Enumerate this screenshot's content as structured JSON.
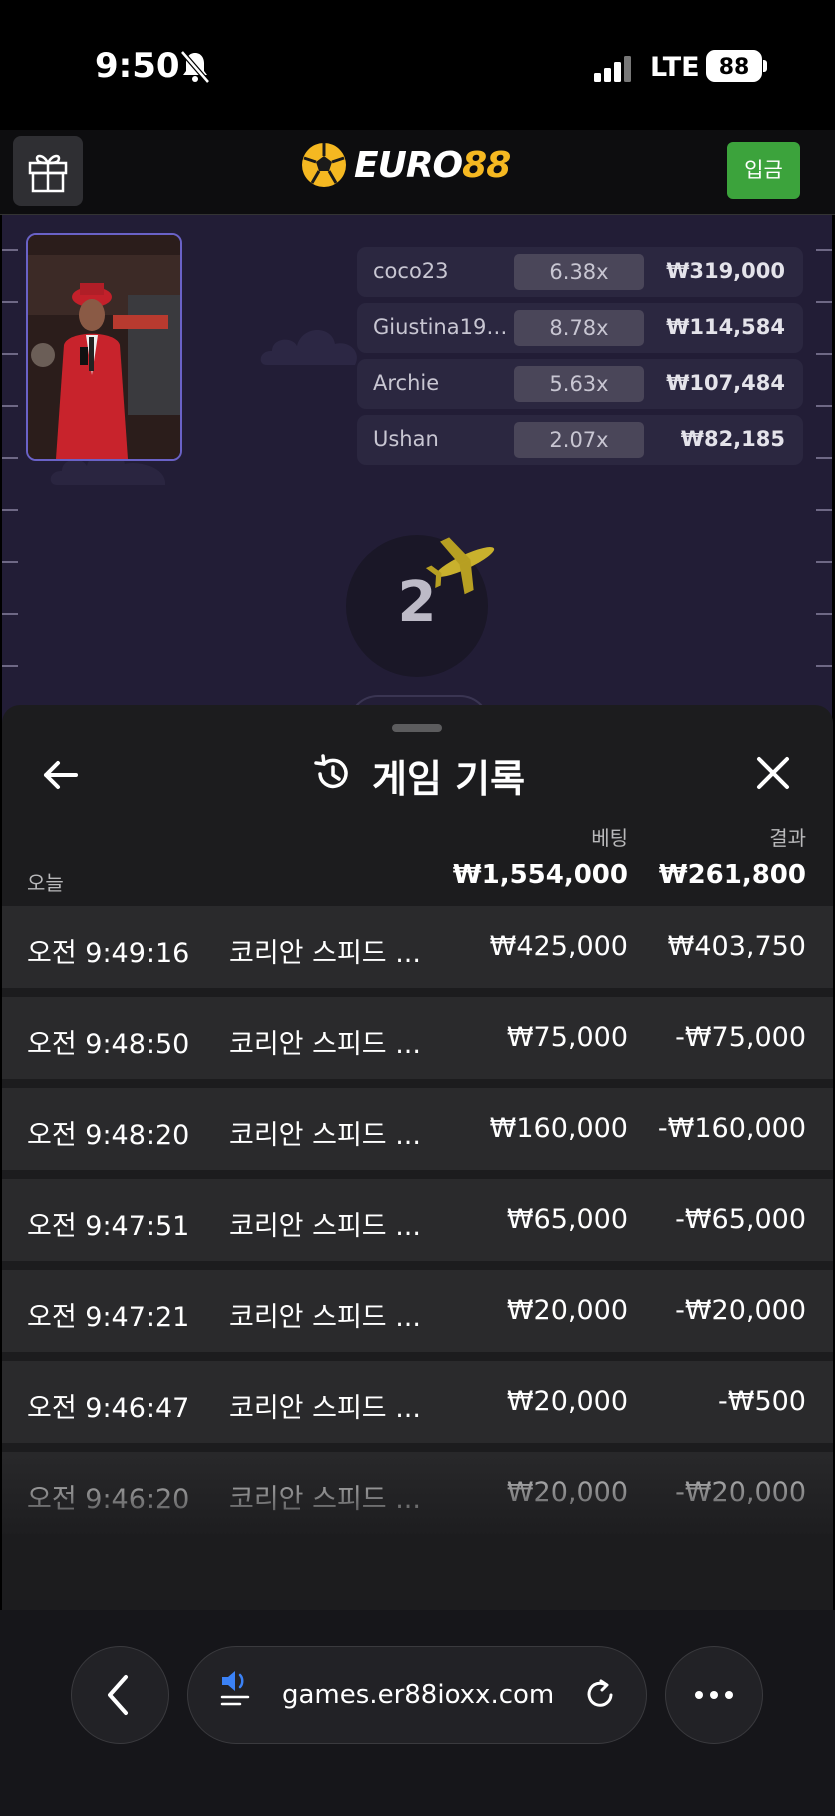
{
  "status_bar": {
    "time": "9:50",
    "network": "LTE",
    "battery": "88"
  },
  "header": {
    "logo": "EURO88",
    "logo_word": "EURO",
    "logo_number": "88",
    "deposit_label": "입금"
  },
  "live_bets": [
    {
      "name": "coco23",
      "multiplier": "6.38x",
      "amount": "₩319,000"
    },
    {
      "name": "Giustina19…",
      "multiplier": "8.78x",
      "amount": "₩114,584"
    },
    {
      "name": "Archie",
      "multiplier": "5.63x",
      "amount": "₩107,484"
    },
    {
      "name": "Ushan",
      "multiplier": "2.07x",
      "amount": "₩82,185"
    }
  ],
  "countdown": "2",
  "history": {
    "title": "게임 기록",
    "bet_header": "베팅",
    "result_header": "결과",
    "today_label": "오늘",
    "total_bet": "₩1,554,000",
    "total_result": "₩261,800",
    "rows": [
      {
        "time": "오전 9:49:16",
        "game": "코리안 스피드 ...",
        "bet": "₩425,000",
        "result": "₩403,750"
      },
      {
        "time": "오전 9:48:50",
        "game": "코리안 스피드 ...",
        "bet": "₩75,000",
        "result": "-₩75,000"
      },
      {
        "time": "오전 9:48:20",
        "game": "코리안 스피드 ...",
        "bet": "₩160,000",
        "result": "-₩160,000"
      },
      {
        "time": "오전 9:47:51",
        "game": "코리안 스피드 ...",
        "bet": "₩65,000",
        "result": "-₩65,000"
      },
      {
        "time": "오전 9:47:21",
        "game": "코리안 스피드 ...",
        "bet": "₩20,000",
        "result": "-₩20,000"
      },
      {
        "time": "오전 9:46:47",
        "game": "코리안 스피드 ...",
        "bet": "₩20,000",
        "result": "-₩500"
      },
      {
        "time": "오전 9:46:20",
        "game": "코리안 스피드 ...",
        "bet": "₩20,000",
        "result": "-₩20,000"
      }
    ]
  },
  "browser": {
    "url": "games.er88ioxx.com"
  }
}
